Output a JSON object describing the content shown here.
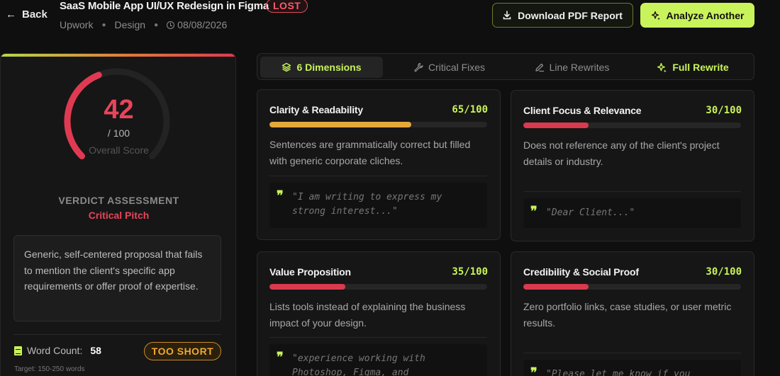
{
  "header": {
    "back_label": "Back",
    "title": "SaaS Mobile App UI/UX Redesign in Figma",
    "status": "LOST",
    "platform": "Upwork",
    "category": "Design",
    "date": "08/08/2026",
    "download_label": "Download PDF Report",
    "analyze_label": "Analyze Another"
  },
  "score_panel": {
    "score": "42",
    "out_of": "/ 100",
    "score_label": "Overall Score",
    "score_fraction": 0.42,
    "verdict_title": "VERDICT ASSESSMENT",
    "verdict_value": "Critical Pitch",
    "summary": "Generic, self-centered proposal that fails to mention the client's specific app requirements or offer proof of expertise.",
    "word_count_label": "Word Count:",
    "word_count": "58",
    "length_badge": "TOO SHORT",
    "target": "Target: 150-250 words",
    "colors": {
      "danger": "#e8455a",
      "accent": "#c9f35a",
      "warning": "#f0a830"
    }
  },
  "tabs": [
    {
      "label": "6 Dimensions",
      "icon": "layers-icon"
    },
    {
      "label": "Critical Fixes",
      "icon": "wrench-icon"
    },
    {
      "label": "Line Rewrites",
      "icon": "pencil-icon"
    },
    {
      "label": "Full Rewrite",
      "icon": "sparkles-icon"
    }
  ],
  "dimensions": [
    {
      "title": "Clarity & Readability",
      "score": "65/100",
      "value": 65,
      "color": "#e5a83a",
      "description": "Sentences are grammatically correct but filled with generic corporate cliches.",
      "quote": "\"I am writing to express my strong interest...\""
    },
    {
      "title": "Client Focus & Relevance",
      "score": "30/100",
      "value": 30,
      "color": "#d93a4e",
      "description": "Does not reference any of the client's project details or industry.",
      "quote": "\"Dear Client...\""
    },
    {
      "title": "Value Proposition",
      "score": "35/100",
      "value": 35,
      "color": "#d93a4e",
      "description": "Lists tools instead of explaining the business impact of your design.",
      "quote": "\"experience working with Photoshop, Figma, and"
    },
    {
      "title": "Credibility & Social Proof",
      "score": "30/100",
      "value": 30,
      "color": "#d93a4e",
      "description": "Zero portfolio links, case studies, or user metric results.",
      "quote": "\"Please let me know if you"
    }
  ]
}
